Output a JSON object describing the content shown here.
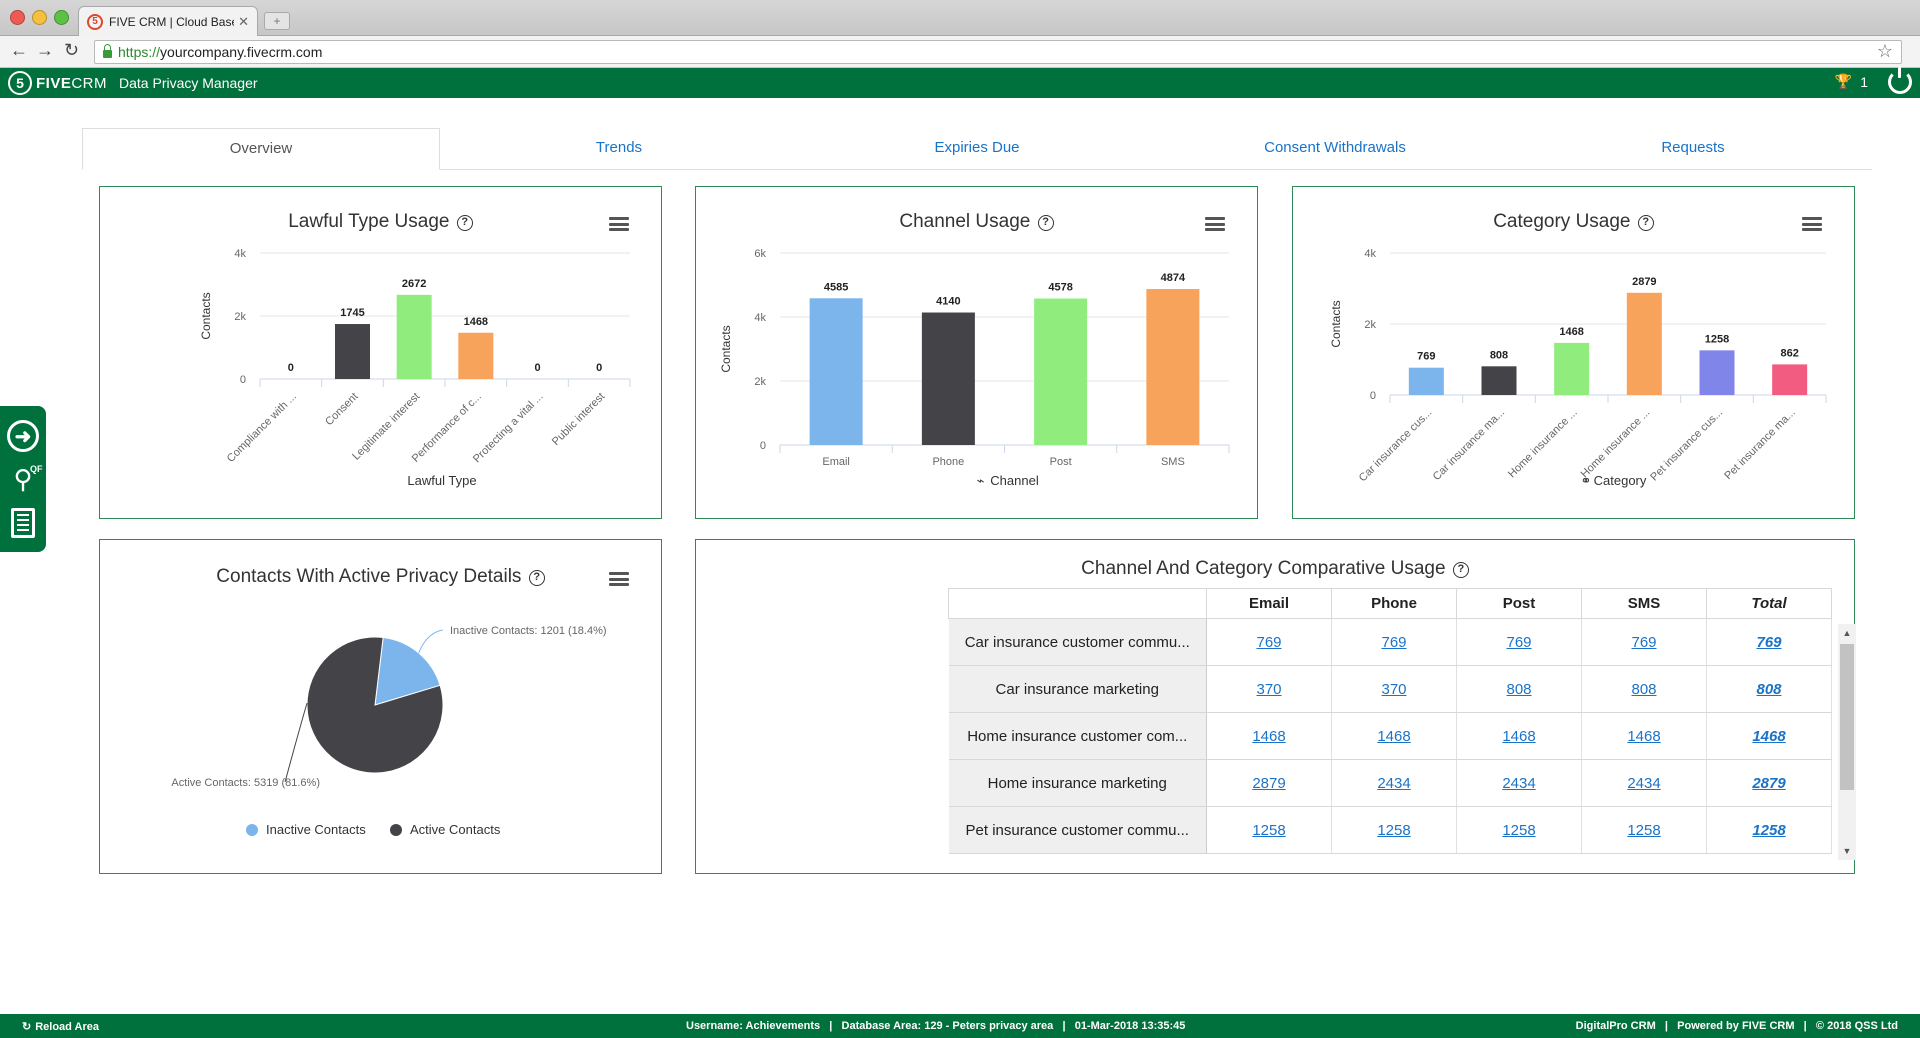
{
  "browser": {
    "tab_title": "FIVE CRM | Cloud Based Sa",
    "favicon_text": "5",
    "url_scheme": "https://",
    "url_host": "yourcompany.fivecrm.com"
  },
  "header": {
    "logo_num": "5",
    "logo_five": "FIVE",
    "logo_crm": "CRM",
    "module_title": "Data Privacy Manager",
    "trophy_count": "1"
  },
  "tabs": [
    {
      "label": "Overview"
    },
    {
      "label": "Trends"
    },
    {
      "label": "Expiries Due"
    },
    {
      "label": "Consent Withdrawals"
    },
    {
      "label": "Requests"
    }
  ],
  "panels": {
    "lawful": {
      "title": "Lawful Type Usage"
    },
    "channel": {
      "title": "Channel Usage"
    },
    "category": {
      "title": "Category Usage"
    },
    "contacts": {
      "title": "Contacts With Active Privacy Details"
    },
    "comparative": {
      "title": "Channel And Category Comparative Usage"
    }
  },
  "chart_data": [
    {
      "id": "lawful",
      "type": "bar",
      "title": "Lawful Type Usage",
      "xlabel": "Lawful Type",
      "ylabel": "Contacts",
      "ylim": [
        0,
        4000
      ],
      "yticks": [
        "0",
        "2k",
        "4k"
      ],
      "categories": [
        "Compliance with ...",
        "Consent",
        "Legitimate interest",
        "Performance of c...",
        "Protecting a vital ...",
        "Public interest"
      ],
      "values": [
        0,
        1745,
        2672,
        1468,
        0,
        0
      ],
      "colors": [
        "#7cb5ec",
        "#434348",
        "#90ed7d",
        "#f7a35c",
        "#8085e9",
        "#f15c80"
      ]
    },
    {
      "id": "channel",
      "type": "bar",
      "title": "Channel Usage",
      "xlabel": "Channel",
      "ylabel": "Contacts",
      "ylim": [
        0,
        6000
      ],
      "yticks": [
        "0",
        "2k",
        "4k",
        "6k"
      ],
      "categories": [
        "Email",
        "Phone",
        "Post",
        "SMS"
      ],
      "values": [
        4585,
        4140,
        4578,
        4874
      ],
      "colors": [
        "#7cb5ec",
        "#434348",
        "#90ed7d",
        "#f7a35c"
      ]
    },
    {
      "id": "category",
      "type": "bar",
      "title": "Category Usage",
      "xlabel": "Category",
      "ylabel": "Contacts",
      "ylim": [
        0,
        4000
      ],
      "yticks": [
        "0",
        "2k",
        "4k"
      ],
      "categories": [
        "Car insurance cus...",
        "Car insurance ma...",
        "Home insurance ...",
        "Home insurance ...",
        "Pet insurance cus...",
        "Pet insurance ma..."
      ],
      "values": [
        769,
        808,
        1468,
        2879,
        1258,
        862
      ],
      "colors": [
        "#7cb5ec",
        "#434348",
        "#90ed7d",
        "#f7a35c",
        "#8085e9",
        "#f15c80"
      ]
    },
    {
      "id": "contacts",
      "type": "pie",
      "title": "Contacts With Active Privacy Details",
      "slices": [
        {
          "name": "Inactive Contacts",
          "value": 1201,
          "percent": 18.4,
          "label": "Inactive Contacts: 1201 (18.4%)",
          "color": "#7cb5ec"
        },
        {
          "name": "Active Contacts",
          "value": 5319,
          "percent": 81.6,
          "label": "Active Contacts: 5319 (81.6%)",
          "color": "#434348"
        }
      ],
      "legend": [
        "Inactive Contacts",
        "Active Contacts"
      ],
      "legend_placement": "bottom"
    }
  ],
  "table": {
    "headers": [
      "Email",
      "Phone",
      "Post",
      "SMS",
      "Total"
    ],
    "rows": [
      {
        "label": "Car insurance customer commu...",
        "values": [
          "769",
          "769",
          "769",
          "769",
          "769"
        ]
      },
      {
        "label": "Car insurance marketing",
        "values": [
          "370",
          "370",
          "808",
          "808",
          "808"
        ]
      },
      {
        "label": "Home insurance customer com...",
        "values": [
          "1468",
          "1468",
          "1468",
          "1468",
          "1468"
        ]
      },
      {
        "label": "Home insurance marketing",
        "values": [
          "2879",
          "2434",
          "2434",
          "2434",
          "2879"
        ]
      },
      {
        "label": "Pet insurance customer commu...",
        "values": [
          "1258",
          "1258",
          "1258",
          "1258",
          "1258"
        ]
      }
    ]
  },
  "footer": {
    "reload": "Reload Area",
    "status": "Username: Achievements   |   Database Area: 129 - Peters privacy area   |   01-Mar-2018 13:35:45",
    "credits": "DigitalPro CRM   |   Powered by FIVE CRM   |   © 2018 QSS Ltd"
  },
  "icons": {
    "trophy": "trophy-icon",
    "power": "power-icon",
    "help": "help-icon",
    "menu": "hamburger-menu-icon",
    "channel_axis": "rss-icon",
    "category_axis": "link-icon"
  }
}
